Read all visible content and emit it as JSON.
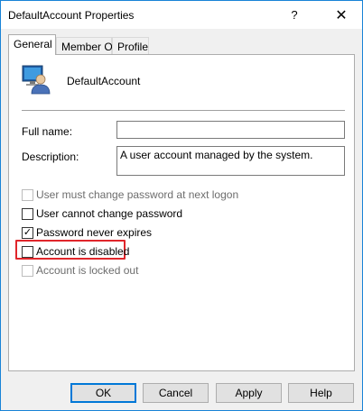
{
  "window": {
    "title": "DefaultAccount Properties",
    "help_glyph": "?",
    "close_glyph": "✕"
  },
  "tabs": [
    {
      "label": "General",
      "active": true
    },
    {
      "label": "Member Of",
      "active": false
    },
    {
      "label": "Profile",
      "active": false
    }
  ],
  "account": {
    "name": "DefaultAccount",
    "icon": "user-account-icon"
  },
  "fields": {
    "full_name_label": "Full name:",
    "full_name_value": "",
    "description_label": "Description:",
    "description_value": "A user account managed by the system."
  },
  "checkboxes": [
    {
      "label": "User must change password at next logon",
      "checked": false,
      "enabled": false
    },
    {
      "label": "User cannot change password",
      "checked": false,
      "enabled": true
    },
    {
      "label": "Password never expires",
      "checked": true,
      "enabled": true
    },
    {
      "label": "Account is disabled",
      "checked": false,
      "enabled": true
    },
    {
      "label": "Account is locked out",
      "checked": false,
      "enabled": false
    }
  ],
  "buttons": {
    "ok": "OK",
    "cancel": "Cancel",
    "apply": "Apply",
    "help": "Help"
  },
  "colors": {
    "window_border": "#1883d7",
    "highlight_border": "#e0262b",
    "default_button_border": "#0078d7"
  }
}
